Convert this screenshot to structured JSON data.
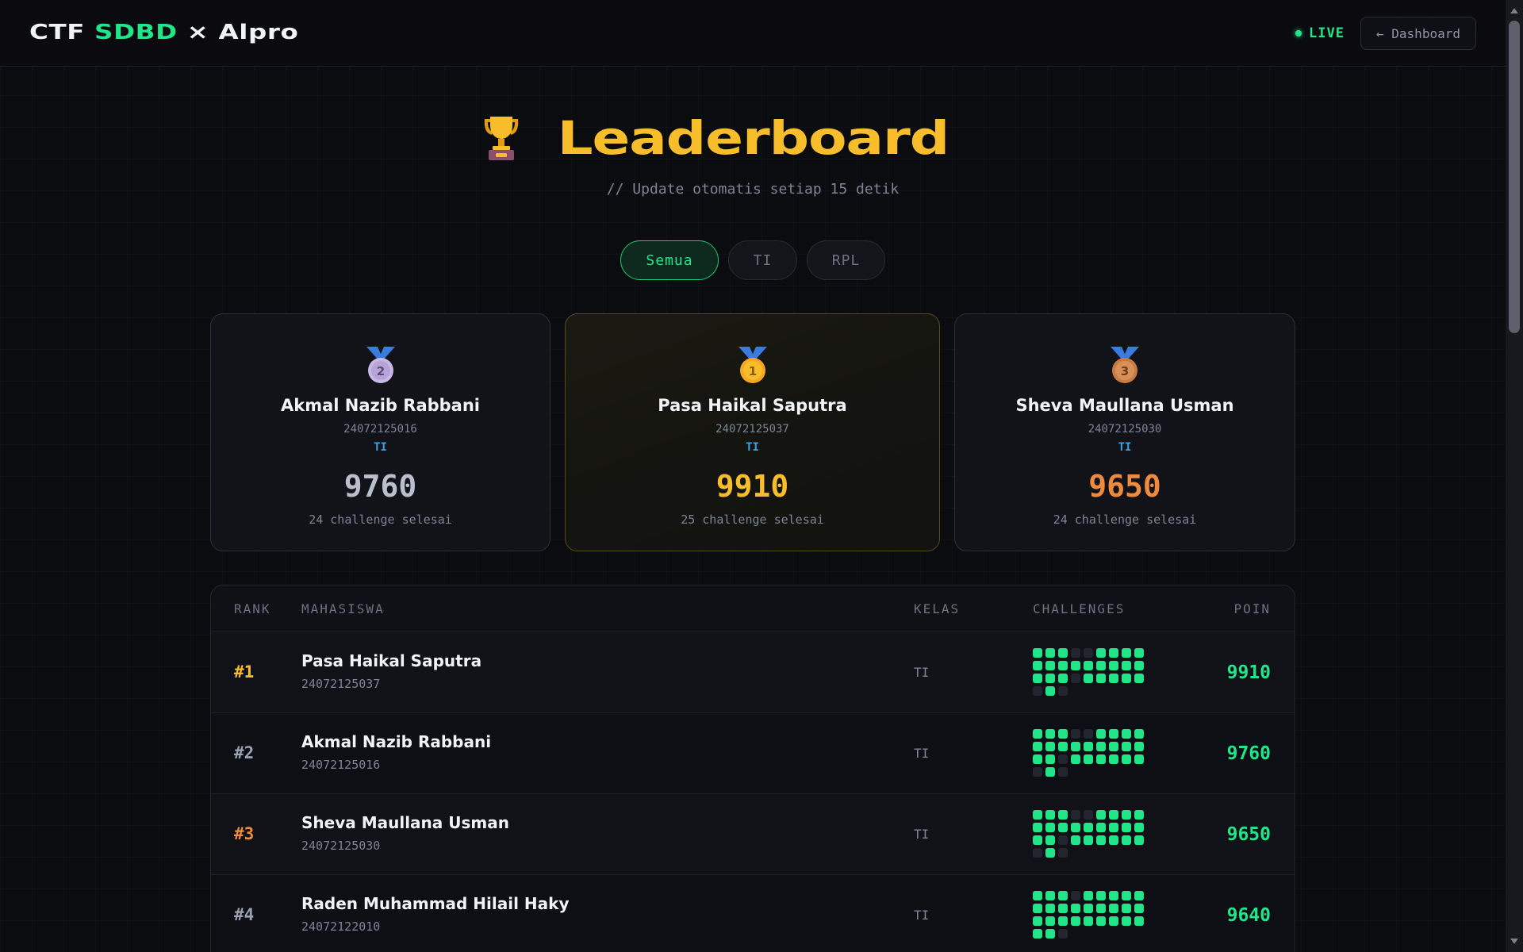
{
  "header": {
    "brand_part1": "CTF",
    "brand_accent": "SDBD",
    "brand_part2": "× Alpro",
    "live_label": "LIVE",
    "dashboard_button": "← Dashboard"
  },
  "hero": {
    "title": "Leaderboard",
    "subtitle": "// Update otomatis setiap 15 detik",
    "trophy_icon": "trophy-icon"
  },
  "filters": [
    {
      "label": "Semua",
      "active": true
    },
    {
      "label": "TI",
      "active": false
    },
    {
      "label": "RPL",
      "active": false
    }
  ],
  "podium": [
    {
      "place": "2",
      "name": "Akmal Nazib Rabbani",
      "nim": "24072125016",
      "kelas": "TI",
      "points": "9760",
      "solved": "24 challenge selesai",
      "color": "#b9bfcc",
      "medal_color": "#c9b8e6"
    },
    {
      "place": "1",
      "name": "Pasa Haikal Saputra",
      "nim": "24072125037",
      "kelas": "TI",
      "points": "9910",
      "solved": "25 challenge selesai",
      "color": "#f7bd2a",
      "medal_color": "#f5a623"
    },
    {
      "place": "3",
      "name": "Sheva Maullana Usman",
      "nim": "24072125030",
      "kelas": "TI",
      "points": "9650",
      "solved": "24 challenge selesai",
      "color": "#f08a3c",
      "medal_color": "#c77b44"
    }
  ],
  "table": {
    "headers": {
      "rank": "RANK",
      "student": "MAHASISWA",
      "kelas": "KELAS",
      "challenges": "CHALLENGES",
      "points": "POIN"
    },
    "rows": [
      {
        "rank": "#1",
        "rank_color": "#f7bd2a",
        "name": "Pasa Haikal Saputra",
        "nim": "24072125037",
        "kelas": "TI",
        "points": "9910",
        "challenges": [
          1,
          1,
          1,
          0,
          0,
          1,
          1,
          1,
          1,
          1,
          1,
          1,
          1,
          1,
          1,
          1,
          1,
          1,
          1,
          1,
          1,
          0,
          1,
          1,
          1,
          1,
          1,
          0,
          1,
          0
        ]
      },
      {
        "rank": "#2",
        "rank_color": "#9aa2b2",
        "name": "Akmal Nazib Rabbani",
        "nim": "24072125016",
        "kelas": "TI",
        "points": "9760",
        "challenges": [
          1,
          1,
          1,
          0,
          0,
          1,
          1,
          1,
          1,
          1,
          1,
          1,
          1,
          1,
          1,
          1,
          1,
          1,
          1,
          1,
          0,
          1,
          1,
          1,
          1,
          1,
          1,
          0,
          1,
          0
        ]
      },
      {
        "rank": "#3",
        "rank_color": "#f08a3c",
        "name": "Sheva Maullana Usman",
        "nim": "24072125030",
        "kelas": "TI",
        "points": "9650",
        "challenges": [
          1,
          1,
          1,
          0,
          0,
          1,
          1,
          1,
          1,
          1,
          1,
          1,
          1,
          1,
          1,
          1,
          1,
          1,
          1,
          1,
          0,
          1,
          1,
          1,
          1,
          1,
          1,
          0,
          1,
          0
        ]
      },
      {
        "rank": "#4",
        "rank_color": "#9aa2b2",
        "name": "Raden Muhammad Hilail Haky",
        "nim": "24072122010",
        "kelas": "TI",
        "points": "9640",
        "challenges": [
          1,
          1,
          1,
          0,
          1,
          1,
          1,
          1,
          1,
          1,
          1,
          1,
          1,
          1,
          1,
          1,
          1,
          1,
          1,
          1,
          1,
          1,
          1,
          1,
          1,
          1,
          1,
          1,
          1,
          0
        ]
      }
    ]
  }
}
